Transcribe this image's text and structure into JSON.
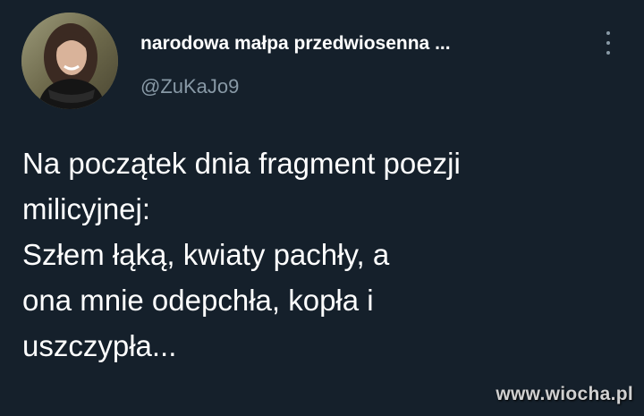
{
  "tweet": {
    "author": {
      "display_name": "narodowa małpa przedwiosenna ...",
      "handle": "@ZuKaJo9"
    },
    "text_lines": [
      "Na początek dnia fragment poezji",
      "milicyjnej:",
      "Szłem łąką, kwiaty pachły, a",
      "ona mnie odepchła, kopła i",
      "uszczypła..."
    ]
  },
  "watermark": {
    "text": "www.wiocha.pl"
  },
  "icons": {
    "more": "more-vertical-icon",
    "avatar": "profile-photo"
  },
  "colors": {
    "background": "#15202b",
    "primary_text": "#ffffff",
    "secondary_text": "#8899a6"
  }
}
